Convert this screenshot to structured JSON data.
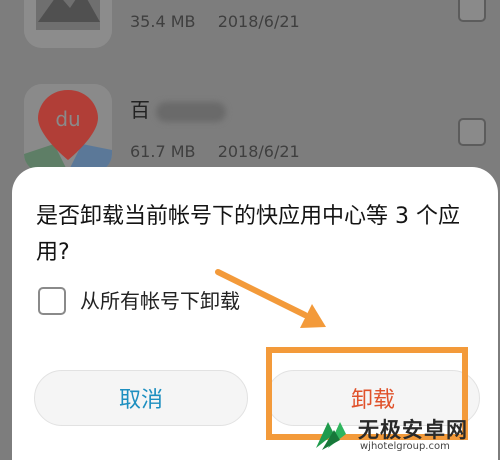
{
  "apps": [
    {
      "size": "35.4 MB",
      "date": "2018/6/21",
      "name": ""
    },
    {
      "size": "61.7 MB",
      "date": "2018/6/21",
      "name": "百"
    }
  ],
  "dialog": {
    "message": "是否卸载当前帐号下的快应用中心等 3 个应用?",
    "option_label": "从所有帐号下卸载",
    "cancel_label": "取消",
    "uninstall_label": "卸载"
  },
  "icons": {
    "map_pin_text": "du"
  },
  "watermark": {
    "brand": "无极安卓网",
    "url": "wjhotelgroup.com"
  },
  "colors": {
    "accent": "#1d8fc0",
    "danger": "#e0522b",
    "annotation": "#f39a3a"
  }
}
